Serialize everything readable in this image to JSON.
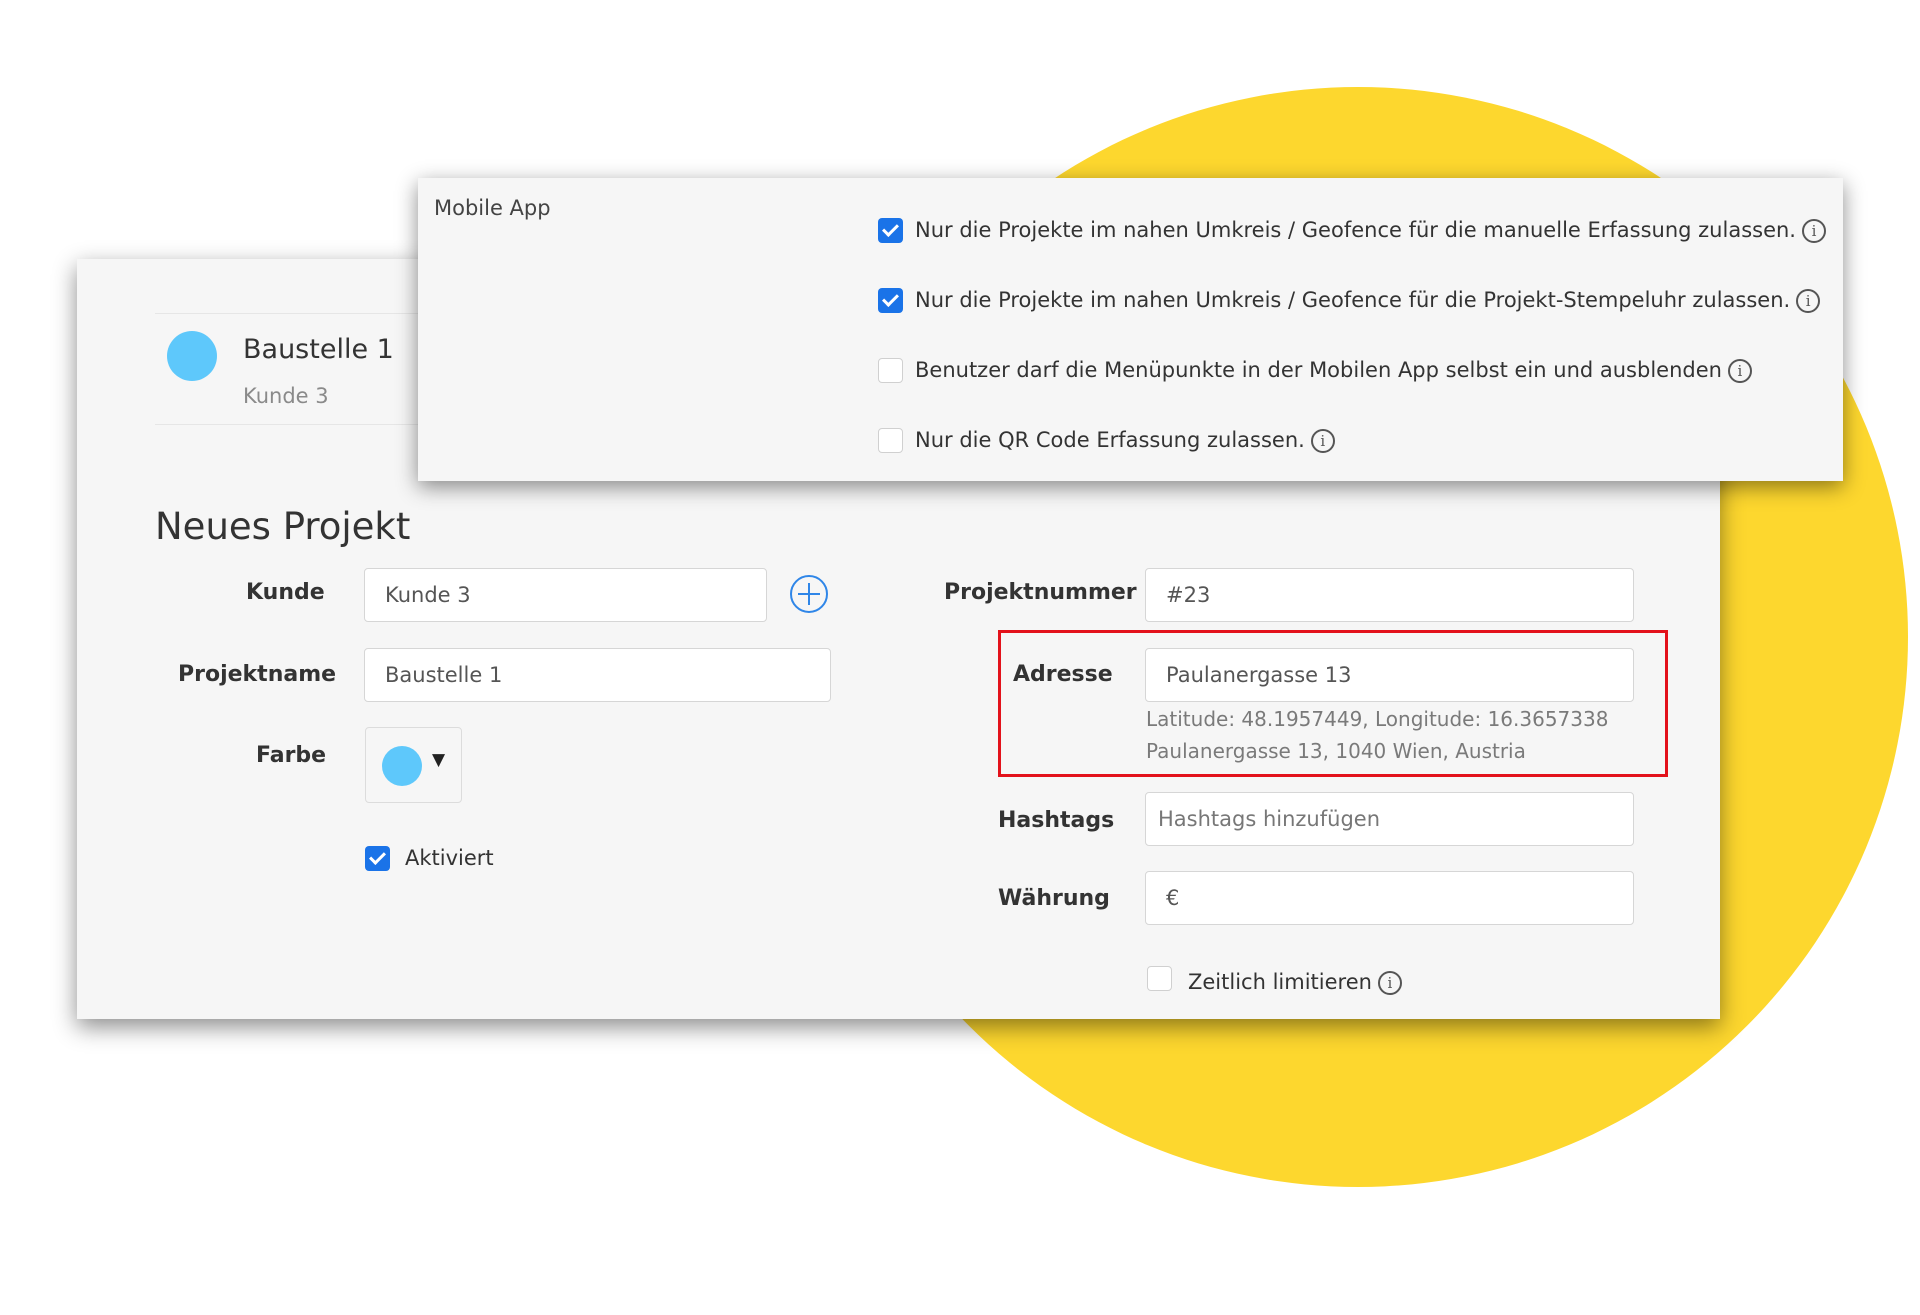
{
  "header": {
    "title": "Baustelle 1",
    "subtitle": "Kunde 3"
  },
  "form": {
    "title": "Neues Projekt",
    "kunde": {
      "label": "Kunde",
      "value": "Kunde 3"
    },
    "projektname": {
      "label": "Projektname",
      "value": "Baustelle 1"
    },
    "farbe": {
      "label": "Farbe",
      "color": "#5ec8fb"
    },
    "aktiviert": {
      "label": "Aktiviert",
      "checked": true
    },
    "projektnummer": {
      "label": "Projektnummer",
      "value": "#23"
    },
    "adresse": {
      "label": "Adresse",
      "value": "Paulanergasse 13",
      "coords": "Latitude: 48.1957449, Longitude: 16.3657338",
      "resolved": "Paulanergasse 13, 1040 Wien, Austria"
    },
    "hashtags": {
      "label": "Hashtags",
      "placeholder": "Hashtags hinzufügen"
    },
    "waehrung": {
      "label": "Währung",
      "value": "€"
    },
    "zeitlich": {
      "label": "Zeitlich limitieren",
      "checked": false
    }
  },
  "mobile_app": {
    "title": "Mobile App",
    "options": [
      {
        "label": "Nur die Projekte im nahen Umkreis / Geofence für die manuelle Erfassung zulassen.",
        "checked": true
      },
      {
        "label": "Nur die Projekte im nahen Umkreis / Geofence für die Projekt-Stempeluhr zulassen.",
        "checked": true
      },
      {
        "label": "Benutzer darf die Menüpunkte in der Mobilen App selbst ein und ausblenden",
        "checked": false
      },
      {
        "label": "Nur die QR Code Erfassung zulassen.",
        "checked": false
      }
    ]
  },
  "icons": {
    "info": "info-icon",
    "add": "plus-circle-icon",
    "caret": "caret-down-icon"
  },
  "colors": {
    "accent": "#1a73e8",
    "highlight": "#e3121b",
    "background_shape": "#fdd72e"
  }
}
